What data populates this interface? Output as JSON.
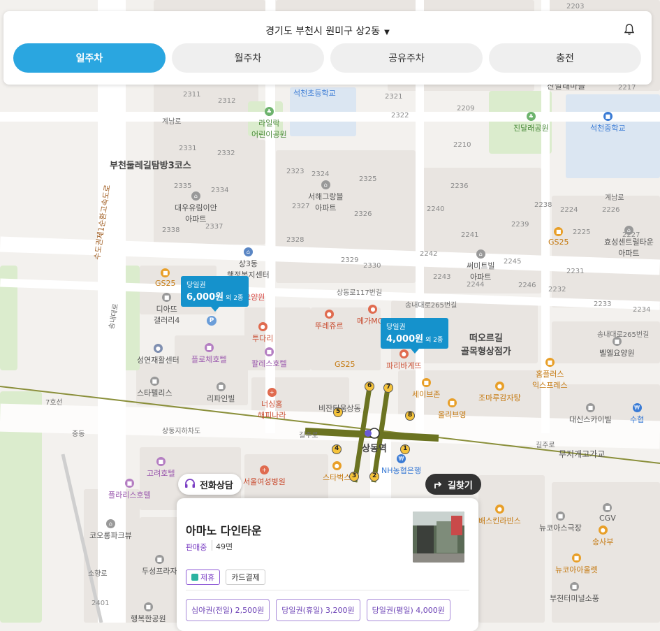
{
  "header": {
    "location": "경기도 부천시 원미구 상2동",
    "tabs": [
      {
        "label": "일주차",
        "active": true
      },
      {
        "label": "월주차",
        "active": false
      },
      {
        "label": "공유주차",
        "active": false
      },
      {
        "label": "충전",
        "active": false
      }
    ],
    "bell_icon": "bell-icon"
  },
  "colors": {
    "accent": "#2aa6e0",
    "marker": "#1592cc",
    "subway_line_7": "#6b7321",
    "partner_purple": "#7b3fc4"
  },
  "map": {
    "area_labels": [
      "부천둘레길탐방3코스",
      "떠오르길",
      "골목형상점가",
      "상동역"
    ],
    "station_exits": [
      "1",
      "2",
      "3",
      "4",
      "5",
      "6",
      "7",
      "8"
    ],
    "road_labels": [
      "계남로",
      "상동로117번길",
      "송내대로265번길",
      "송내대로265번길",
      "길주로",
      "길주로",
      "상동지하차도",
      "무지개고가교",
      "수도권제1순환고속도로",
      "7호선",
      "송내대로",
      "계남로",
      "소향로"
    ],
    "block_numbers": [
      "2203",
      "2311",
      "2312",
      "2321",
      "2322",
      "2209",
      "2210",
      "2217",
      "2331",
      "2332",
      "2335",
      "2334",
      "2338",
      "2337",
      "2323",
      "2324",
      "2325",
      "2327",
      "2326",
      "2328",
      "2329",
      "2330",
      "2236",
      "2238",
      "2240",
      "2239",
      "2241",
      "2242",
      "2243",
      "2245",
      "2244",
      "2246",
      "2224",
      "2226",
      "2227",
      "2225",
      "2231",
      "2232",
      "2233",
      "2234",
      "2401"
    ],
    "pois": [
      {
        "name": "석천초등학교",
        "icon": "school-icon"
      },
      {
        "name": "라일락\n어린이공원",
        "icon": "park-icon"
      },
      {
        "name": "진달래공원",
        "icon": "park-icon"
      },
      {
        "name": "석천중학교",
        "icon": "school-icon"
      },
      {
        "name": "산달래마을",
        "icon": "apartment-icon"
      },
      {
        "name": "대우유림이안\n아파트",
        "icon": "apartment-icon"
      },
      {
        "name": "서해그랑블\n아파트",
        "icon": "apartment-icon"
      },
      {
        "name": "상3동\n행정복지센터",
        "icon": "government-icon"
      },
      {
        "name": "GS25",
        "icon": "store-icon"
      },
      {
        "name": "디아뜨\n갤러리4",
        "icon": "building-icon"
      },
      {
        "name": "요양원",
        "icon": "hospital-icon"
      },
      {
        "name": "뚜레쥬르",
        "icon": "bakery-icon"
      },
      {
        "name": "메가MGC",
        "icon": "cafe-icon"
      },
      {
        "name": "투다리",
        "icon": "restaurant-icon"
      },
      {
        "name": "플로체호텔",
        "icon": "hotel-icon"
      },
      {
        "name": "팔레스호텔",
        "icon": "hotel-icon"
      },
      {
        "name": "성연재활센터",
        "icon": "building-icon"
      },
      {
        "name": "스타펠리스",
        "icon": "building-icon"
      },
      {
        "name": "리파인빌",
        "icon": "building-icon"
      },
      {
        "name": "너싱홈\n해피나라",
        "icon": "hospital-icon"
      },
      {
        "name": "비잔티움상동",
        "icon": "building-icon"
      },
      {
        "name": "파리바게뜨",
        "icon": "bakery-icon"
      },
      {
        "name": "세이브존",
        "icon": "shopping-icon"
      },
      {
        "name": "올리브영",
        "icon": "store-icon"
      },
      {
        "name": "조마루감자탕",
        "icon": "restaurant-icon"
      },
      {
        "name": "홈플러스\n익스프레스",
        "icon": "store-icon"
      },
      {
        "name": "벨엘요양원",
        "icon": "building-icon"
      },
      {
        "name": "대신스카이빌",
        "icon": "building-icon"
      },
      {
        "name": "수협",
        "icon": "bank-icon"
      },
      {
        "name": "써미트빌\n아파트",
        "icon": "apartment-icon"
      },
      {
        "name": "효성센트럴타운\n아파트",
        "icon": "apartment-icon"
      },
      {
        "name": "GS25",
        "icon": "store-icon"
      },
      {
        "name": "고려호텔",
        "icon": "hotel-icon"
      },
      {
        "name": "플라리스호텔",
        "icon": "hotel-icon"
      },
      {
        "name": "코오롱파크뷰",
        "icon": "apartment-icon"
      },
      {
        "name": "두성프라자",
        "icon": "building-icon"
      },
      {
        "name": "행복한공원",
        "icon": "building-icon"
      },
      {
        "name": "서울여성병원",
        "icon": "hospital-icon"
      },
      {
        "name": "스타벅스",
        "icon": "cafe-icon"
      },
      {
        "name": "NH농협은행",
        "icon": "bank-icon"
      },
      {
        "name": "배스킨라빈스",
        "icon": "restaurant-icon"
      },
      {
        "name": "뉴코아스극장",
        "icon": "cinema-icon"
      },
      {
        "name": "CGV",
        "icon": "cinema-icon"
      },
      {
        "name": "송사부",
        "icon": "restaurant-icon"
      },
      {
        "name": "뉴코아아울렛",
        "icon": "shopping-icon"
      },
      {
        "name": "부천터미널소풍",
        "icon": "building-icon"
      },
      {
        "name": "GS25",
        "icon": "store-icon"
      },
      {
        "name": "중동",
        "icon": "ic-icon"
      }
    ]
  },
  "markers": [
    {
      "type": "당일권",
      "price": "6,000원",
      "extra": "외 2종"
    },
    {
      "type": "당일권",
      "price": "4,000원",
      "extra": "외 2종"
    }
  ],
  "buttons": {
    "call": "전화상담",
    "route": "길찾기"
  },
  "parking_card": {
    "title": "아마노 다인타운",
    "status": "판매중",
    "capacity": "49면",
    "badges": [
      {
        "label": "제휴",
        "type": "partner"
      },
      {
        "label": "카드결제",
        "type": "normal"
      }
    ],
    "prices": [
      "심야권(전일) 2,500원",
      "당일권(휴일) 3,200원",
      "당일권(평일) 4,000원"
    ]
  }
}
